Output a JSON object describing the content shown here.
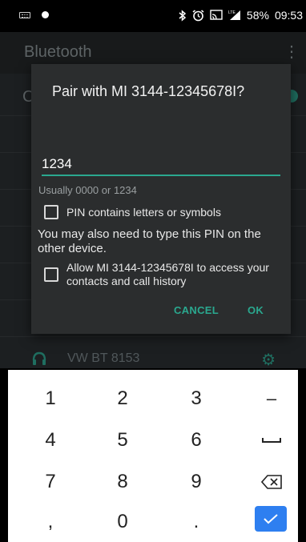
{
  "status_bar": {
    "icons_left": [
      "keyboard-icon",
      "notification-dot-icon"
    ],
    "icons_right": [
      "bluetooth-icon",
      "alarm-icon",
      "cast-icon",
      "lte-signal-icon"
    ],
    "battery": "58%",
    "time": "09:53"
  },
  "app": {
    "title": "Bluetooth",
    "menu_icon": "more-vert-icon",
    "peek_letter": "C",
    "device_name": "VW BT 8153",
    "device_icon": "headset-icon",
    "settings_icon": "gear-icon"
  },
  "dialog": {
    "title": "Pair with MI 3144-12345678I?",
    "pin_value": "1234",
    "hint": "Usually 0000 or 1234",
    "pin_letters_label": "PIN contains letters or symbols",
    "info": "You may also need to type this PIN on the other device.",
    "allow_label": "Allow MI 3144-12345678I to access your contacts and call history",
    "cancel_label": "CANCEL",
    "ok_label": "OK",
    "accent_color": "#2aa88f"
  },
  "keyboard": {
    "rows": [
      [
        "1",
        "2",
        "3",
        "–"
      ],
      [
        "4",
        "5",
        "6",
        "space"
      ],
      [
        "7",
        "8",
        "9",
        "backspace"
      ],
      [
        ",",
        "0",
        ".",
        "done"
      ]
    ],
    "keys": {
      "k1": "1",
      "k2": "2",
      "k3": "3",
      "minus": "–",
      "k4": "4",
      "k5": "5",
      "k6": "6",
      "k7": "7",
      "k8": "8",
      "k9": "9",
      "comma": ",",
      "k0": "0",
      "period": "."
    },
    "done_color": "#2e7ff0"
  }
}
